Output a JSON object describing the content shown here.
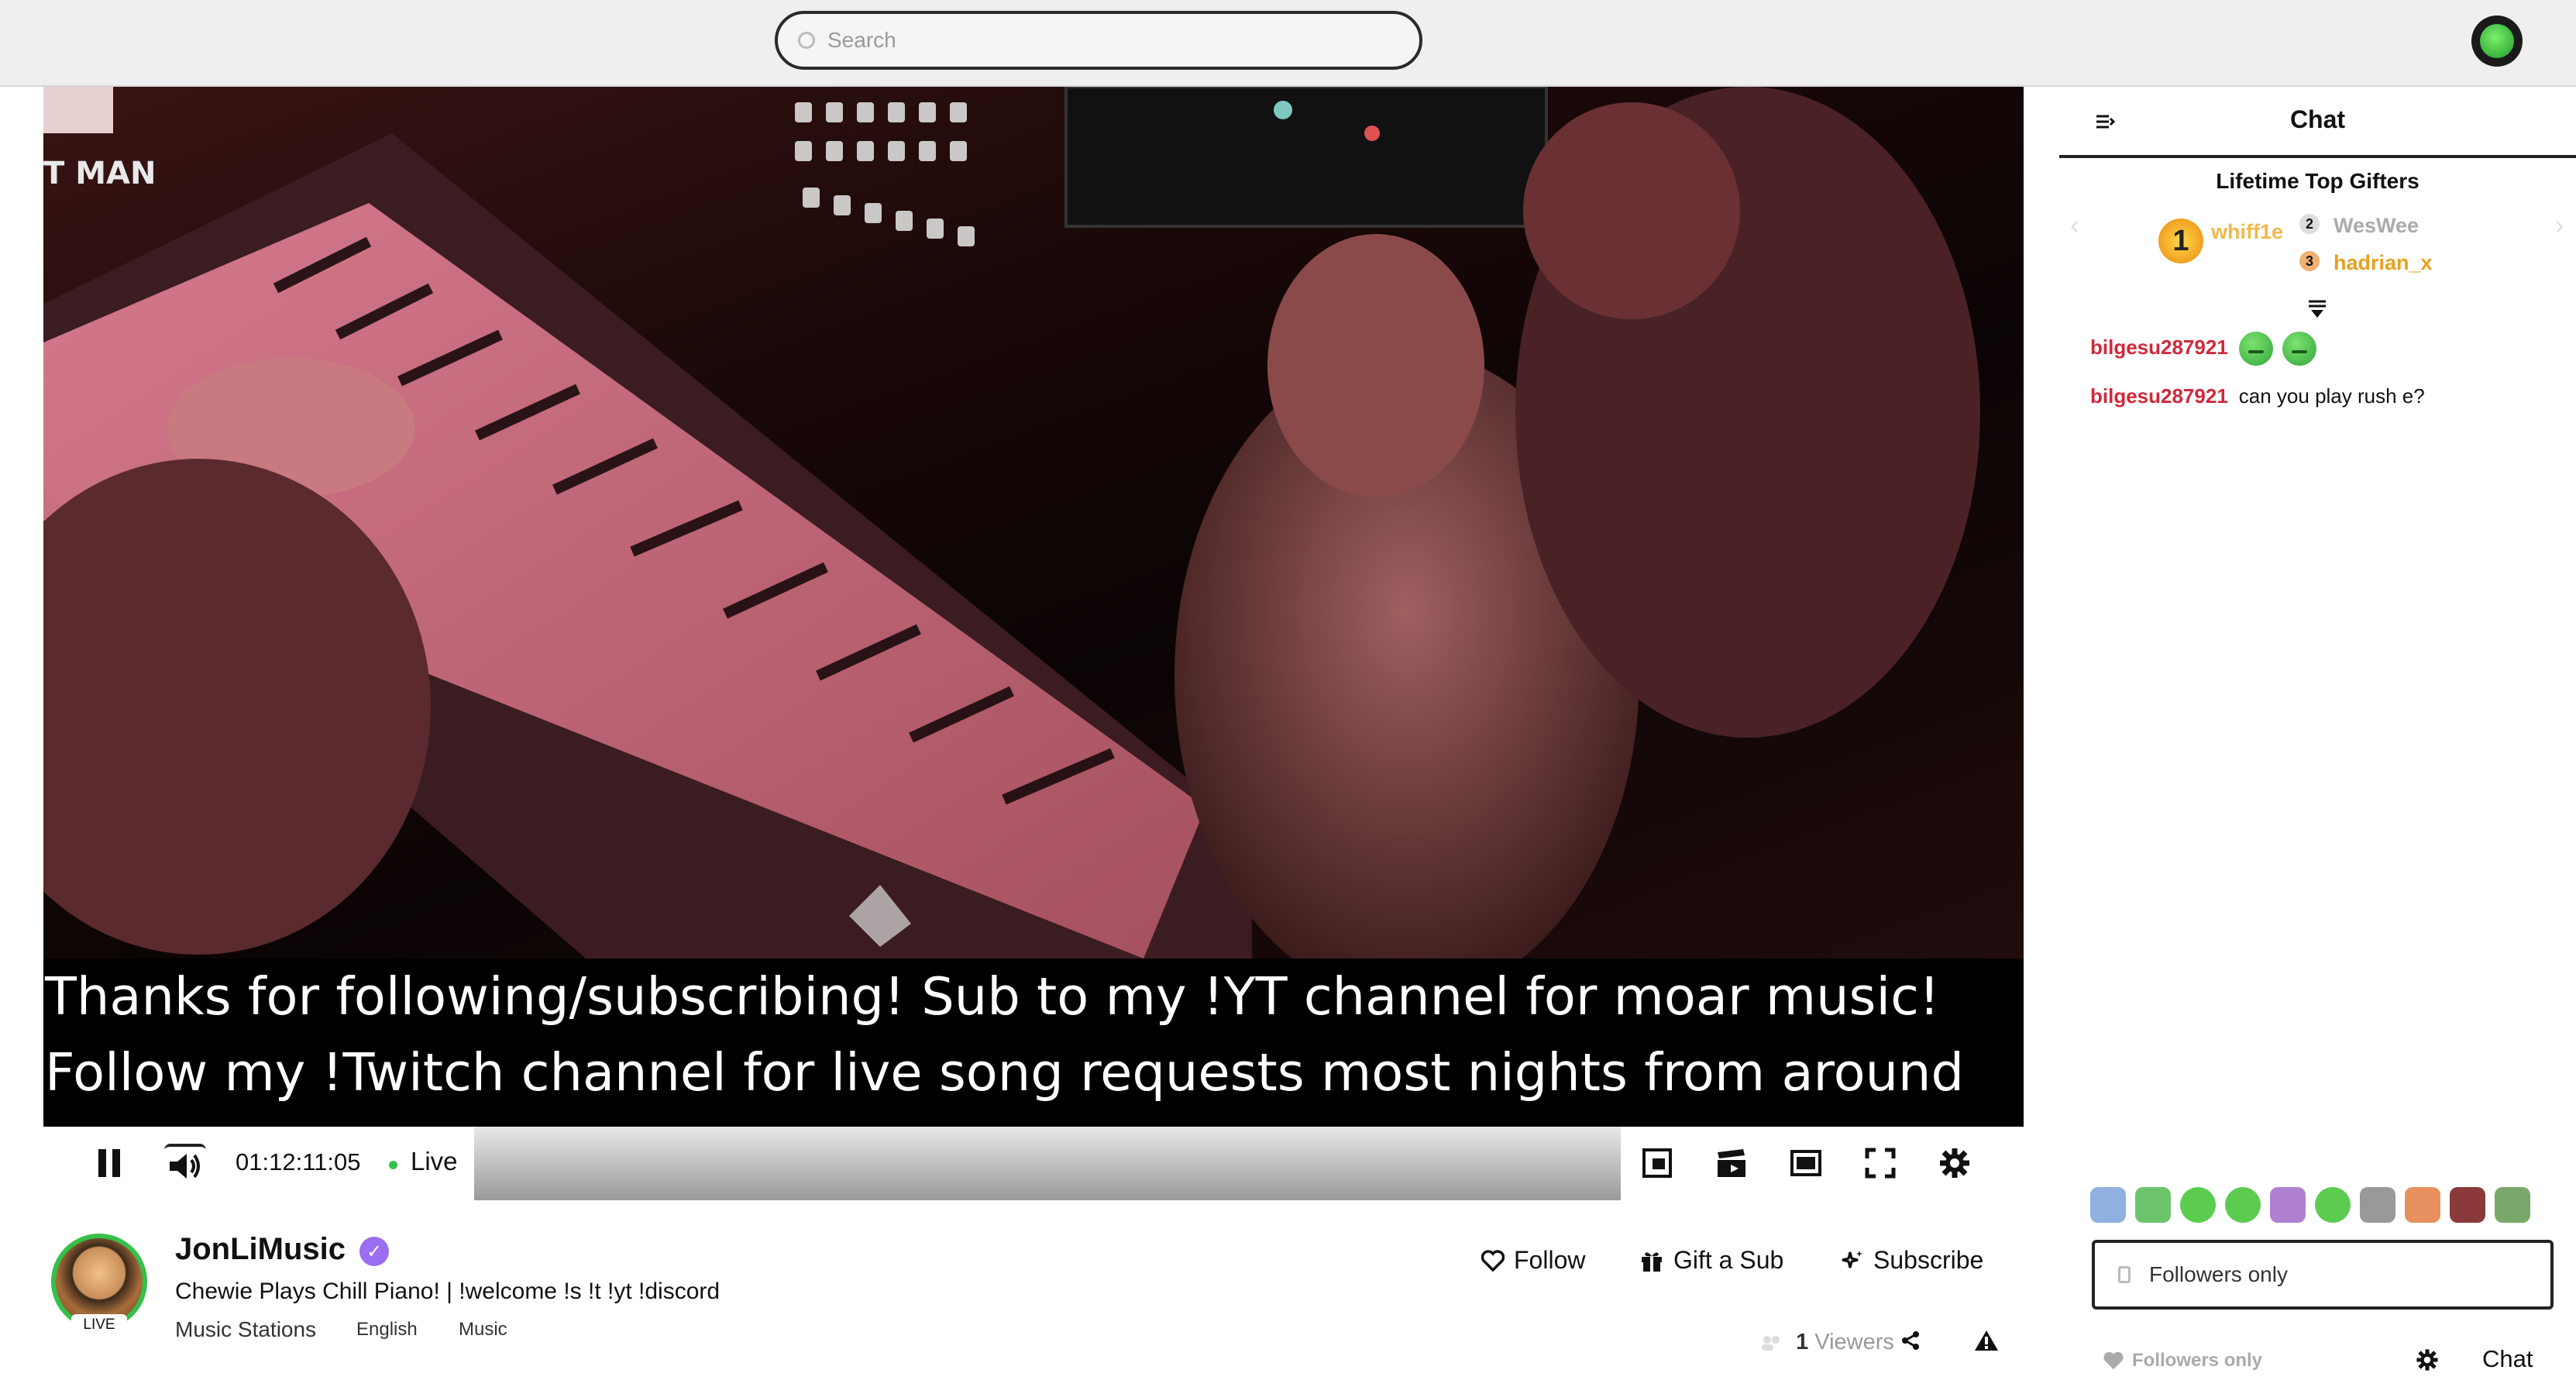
{
  "search": {
    "placeholder": "Search"
  },
  "player": {
    "caption_line1": "Thanks for following/subscribing! Sub to my !YT channel for moar music!",
    "caption_line2": "Follow my !Twitch channel for live song requests most nights from around",
    "time": "01:12:11:05",
    "live_label": "Live",
    "overlay_text": "T MAN"
  },
  "channel": {
    "name": "JonLiMusic",
    "live_badge": "LIVE",
    "title": "Chewie Plays Chill Piano! | !welcome !s !t !yt !discord",
    "category": "Music Stations",
    "tags": [
      "English",
      "Music"
    ],
    "follow_label": "Follow",
    "gift_label": "Gift a Sub",
    "subscribe_label": "Subscribe",
    "viewers_count": "1",
    "viewers_label": "Viewers"
  },
  "chat": {
    "title": "Chat",
    "gifters_title": "Lifetime Top Gifters",
    "gifters": [
      {
        "rank": "1",
        "name": "whiff1e"
      },
      {
        "rank": "2",
        "name": "WesWee"
      },
      {
        "rank": "3",
        "name": "hadrian_x"
      }
    ],
    "messages": [
      {
        "user": "bilgesu287921",
        "text": ""
      },
      {
        "user": "bilgesu287921",
        "text": "can you play rush e?"
      }
    ],
    "input_placeholder": "Followers only",
    "mode_label": "Followers only",
    "send_label": "Chat"
  },
  "colors": {
    "accent": "#35c04a",
    "username": "#d0283c",
    "verified": "#9b6df0"
  }
}
